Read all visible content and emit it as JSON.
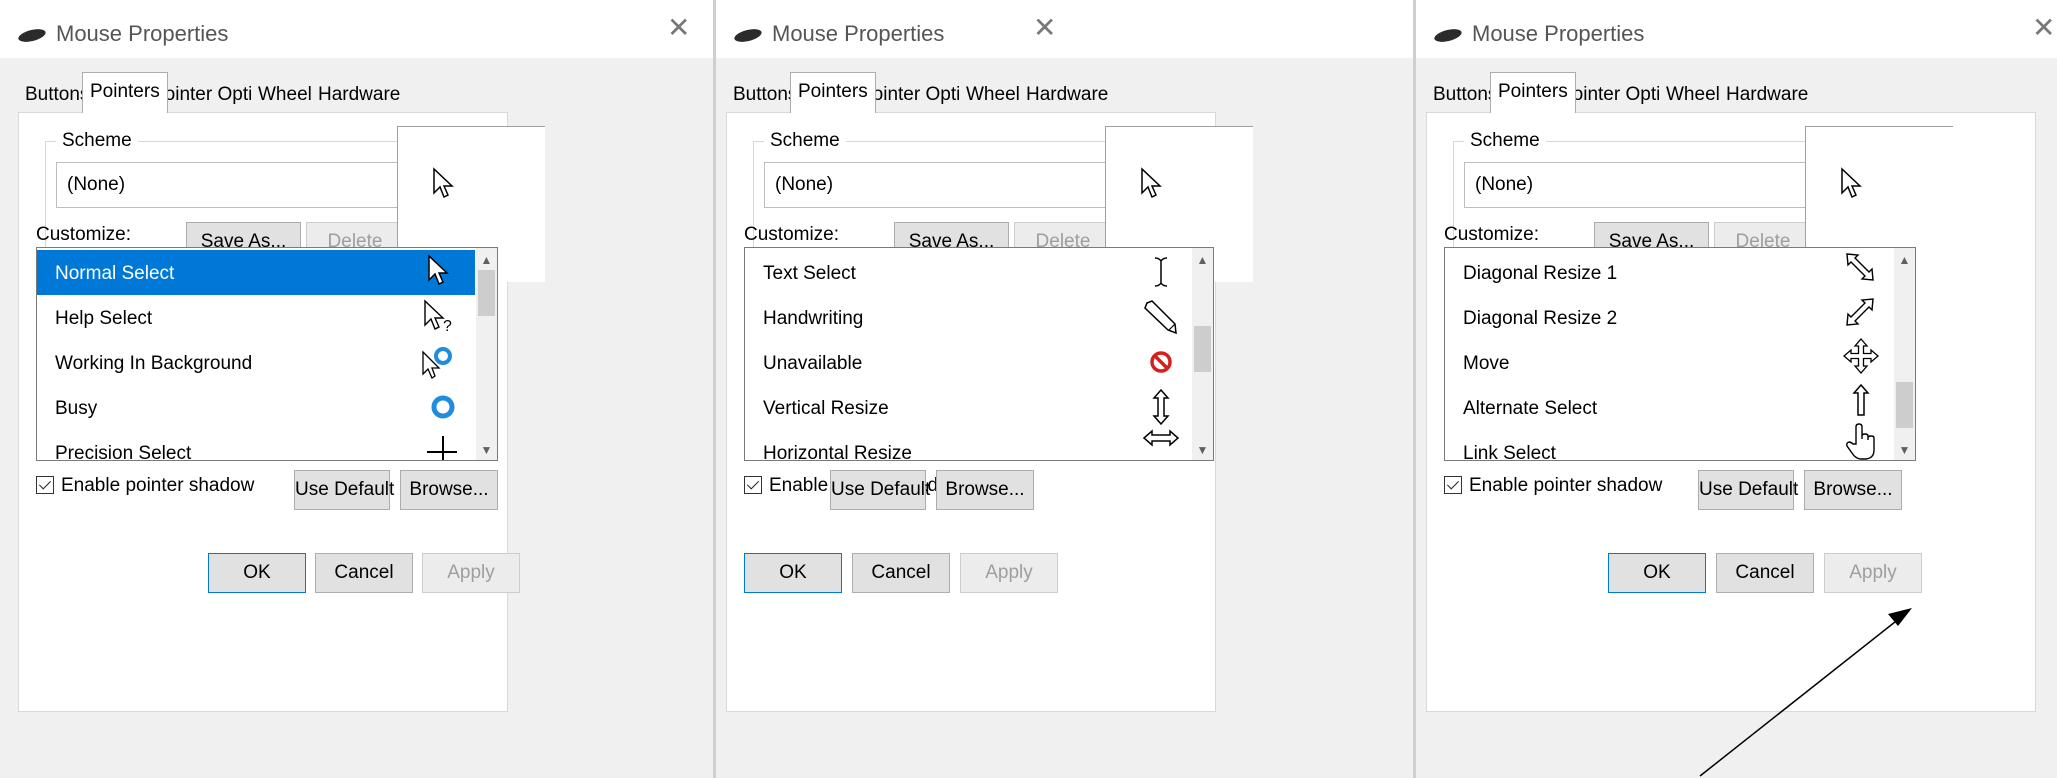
{
  "dialogs": [
    {
      "title": "Mouse Properties",
      "tabs": [
        "Buttons",
        "Pointers",
        "Pointer Options",
        "Wheel",
        "Hardware"
      ],
      "active_tab": "Pointers",
      "scheme": {
        "label": "Scheme",
        "value": "(None)",
        "save_as": "Save As...",
        "delete": "Delete"
      },
      "customize_label": "Customize:",
      "list_items": [
        {
          "label": "Normal Select",
          "icon": "arrow-cursor-icon",
          "selected": true
        },
        {
          "label": "Help Select",
          "icon": "help-cursor-icon",
          "selected": false
        },
        {
          "label": "Working In Background",
          "icon": "working-cursor-icon",
          "selected": false
        },
        {
          "label": "Busy",
          "icon": "busy-cursor-icon",
          "selected": false
        },
        {
          "label": "Precision Select",
          "icon": "crosshair-cursor-icon",
          "selected": false
        }
      ],
      "scroll_position": 0.0,
      "shadow_label": "Enable pointer shadow",
      "shadow_checked": true,
      "use_default": "Use Default",
      "browse": "Browse...",
      "ok": "OK",
      "cancel": "Cancel",
      "apply": "Apply"
    },
    {
      "title": "Mouse Properties",
      "tabs": [
        "Buttons",
        "Pointers",
        "Pointer Options",
        "Wheel",
        "Hardware"
      ],
      "active_tab": "Pointers",
      "scheme": {
        "label": "Scheme",
        "value": "(None)",
        "save_as": "Save As...",
        "delete": "Delete"
      },
      "customize_label": "Customize:",
      "list_items": [
        {
          "label": "Text Select",
          "icon": "text-cursor-icon",
          "selected": false
        },
        {
          "label": "Handwriting",
          "icon": "pen-cursor-icon",
          "selected": false
        },
        {
          "label": "Unavailable",
          "icon": "unavailable-cursor-icon",
          "selected": false
        },
        {
          "label": "Vertical Resize",
          "icon": "vertical-resize-icon",
          "selected": false
        },
        {
          "label": "Horizontal Resize",
          "icon": "horizontal-resize-icon",
          "selected": false
        }
      ],
      "scroll_position": 0.55,
      "shadow_label": "Enable pointer shadow",
      "shadow_checked": true,
      "use_default": "Use Default",
      "browse": "Browse...",
      "ok": "OK",
      "cancel": "Cancel",
      "apply": "Apply"
    },
    {
      "title": "Mouse Properties",
      "tabs": [
        "Buttons",
        "Pointers",
        "Pointer Options",
        "Wheel",
        "Hardware"
      ],
      "active_tab": "Pointers",
      "scheme": {
        "label": "Scheme",
        "value": "(None)",
        "save_as": "Save As...",
        "delete": "Delete"
      },
      "customize_label": "Customize:",
      "list_items": [
        {
          "label": "Diagonal Resize 1",
          "icon": "diagonal-resize-1-icon",
          "selected": false
        },
        {
          "label": "Diagonal Resize 2",
          "icon": "diagonal-resize-2-icon",
          "selected": false
        },
        {
          "label": "Move",
          "icon": "move-cursor-icon",
          "selected": false
        },
        {
          "label": "Alternate Select",
          "icon": "alternate-select-icon",
          "selected": false
        },
        {
          "label": "Link Select",
          "icon": "hand-cursor-icon",
          "selected": false
        }
      ],
      "scroll_position": 1.0,
      "shadow_label": "Enable pointer shadow",
      "shadow_checked": true,
      "use_default": "Use Default",
      "browse": "Browse...",
      "ok": "OK",
      "cancel": "Cancel",
      "apply": "Apply"
    }
  ],
  "colors": {
    "selection": "#0078d7",
    "busy_ring": "#1e8ddf",
    "unavailable": "#d62020",
    "window_bg": "#f0f0f0"
  }
}
